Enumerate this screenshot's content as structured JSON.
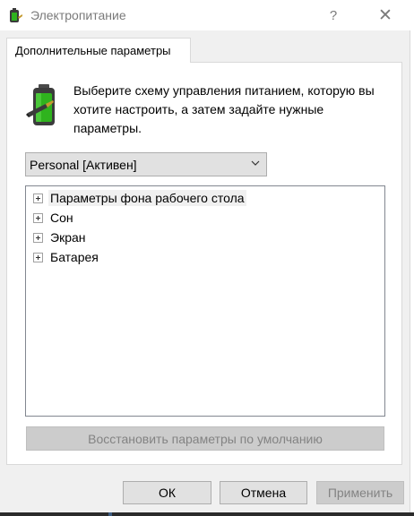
{
  "window": {
    "title": "Электропитание",
    "help_glyph": "?",
    "close_glyph": "✕",
    "icon": "power-options-icon"
  },
  "tab": {
    "label": "Дополнительные параметры"
  },
  "instruction": {
    "text": "Выберите схему управления питанием, которую вы хотите настроить, а затем задайте нужные параметры.",
    "icon": "battery-plug-icon"
  },
  "scheme_select": {
    "selected": "Personal [Активен]"
  },
  "tree": {
    "items": [
      {
        "label": "Параметры фона рабочего стола",
        "selected": true
      },
      {
        "label": "Сон",
        "selected": false
      },
      {
        "label": "Экран",
        "selected": false
      },
      {
        "label": "Батарея",
        "selected": false
      }
    ]
  },
  "buttons": {
    "restore": "Восстановить параметры по умолчанию",
    "ok": "ОК",
    "cancel": "Отмена",
    "apply": "Применить"
  },
  "colors": {
    "window_bg": "#f0f0f0",
    "panel_bg": "#ffffff",
    "button_bg": "#e1e1e1",
    "disabled_text": "#838383",
    "battery_green": "#2fb31e"
  }
}
